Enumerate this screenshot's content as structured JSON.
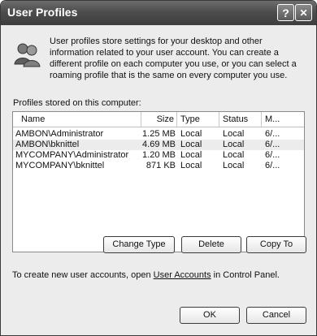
{
  "window": {
    "title": "User Profiles"
  },
  "titlebar": {
    "help_glyph": "?",
    "close_glyph": "✕"
  },
  "intro_text": "Profiles store settings for your desktop and other information related to your user account. You can create a different profile on each computer you use, or you can select a roaming profile that is the same on every computer you use.",
  "intro_text_full": "User profiles store settings for your desktop and other information related to your user account. You can create a different profile on each computer you use, or you can select a roaming profile that is the same on every computer you use.",
  "profiles_label": "Profiles stored on this computer:",
  "table": {
    "headers": [
      "Name",
      "Size",
      "Type",
      "Status",
      "M..."
    ],
    "rows": [
      [
        "AMBON\\Administrator",
        "1.25 MB",
        "Local",
        "Local",
        "6/..."
      ],
      [
        "AMBON\\bknittel",
        "4.69 MB",
        "Local",
        "Local",
        "6/..."
      ],
      [
        "MYCOMPANY\\Administrator",
        "1.20 MB",
        "Local",
        "Local",
        "6/..."
      ],
      [
        "MYCOMPANY\\bknittel",
        "871 KB",
        "Local",
        "Local",
        "6/..."
      ]
    ]
  },
  "buttons": {
    "change_type": "Change Type",
    "delete": "Delete",
    "copy_to": "Copy To",
    "ok": "OK",
    "cancel": "Cancel"
  },
  "footer": {
    "before": "To create new user accounts, open ",
    "link": "User Accounts",
    "after": " in Control Panel."
  }
}
